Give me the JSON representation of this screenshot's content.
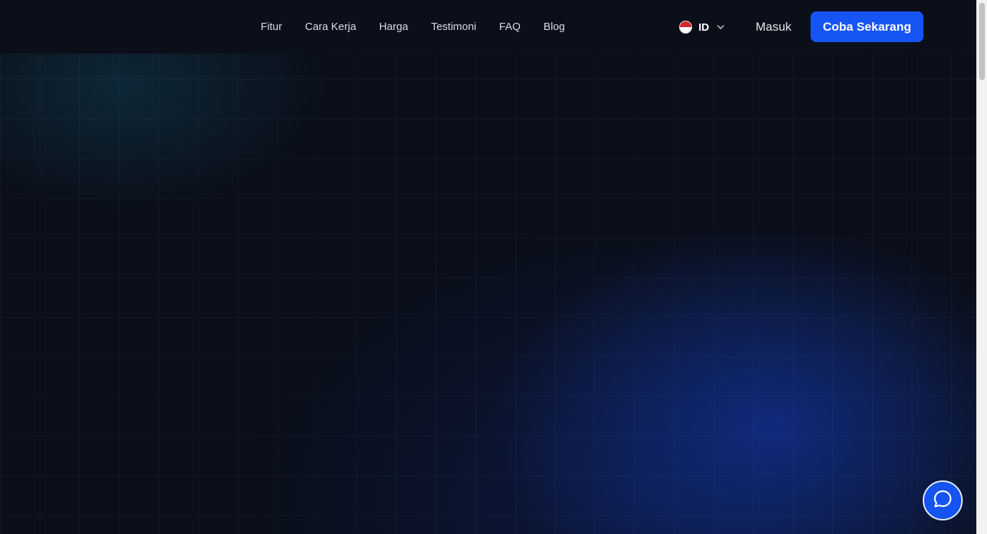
{
  "nav": {
    "links": [
      "Fitur",
      "Cara Kerja",
      "Harga",
      "Testimoni",
      "FAQ",
      "Blog"
    ]
  },
  "language": {
    "code": "ID",
    "flag_icon": "indonesia-flag-icon",
    "dropdown_icon": "chevron-down-icon"
  },
  "auth": {
    "login_label": "Masuk",
    "cta_label": "Coba Sekarang"
  },
  "chat": {
    "icon": "chat-bubble-icon"
  },
  "colors": {
    "background": "#0a0e18",
    "accent": "#1655f4",
    "glow_blue": "#12329a",
    "glow_teal": "#103c50"
  }
}
